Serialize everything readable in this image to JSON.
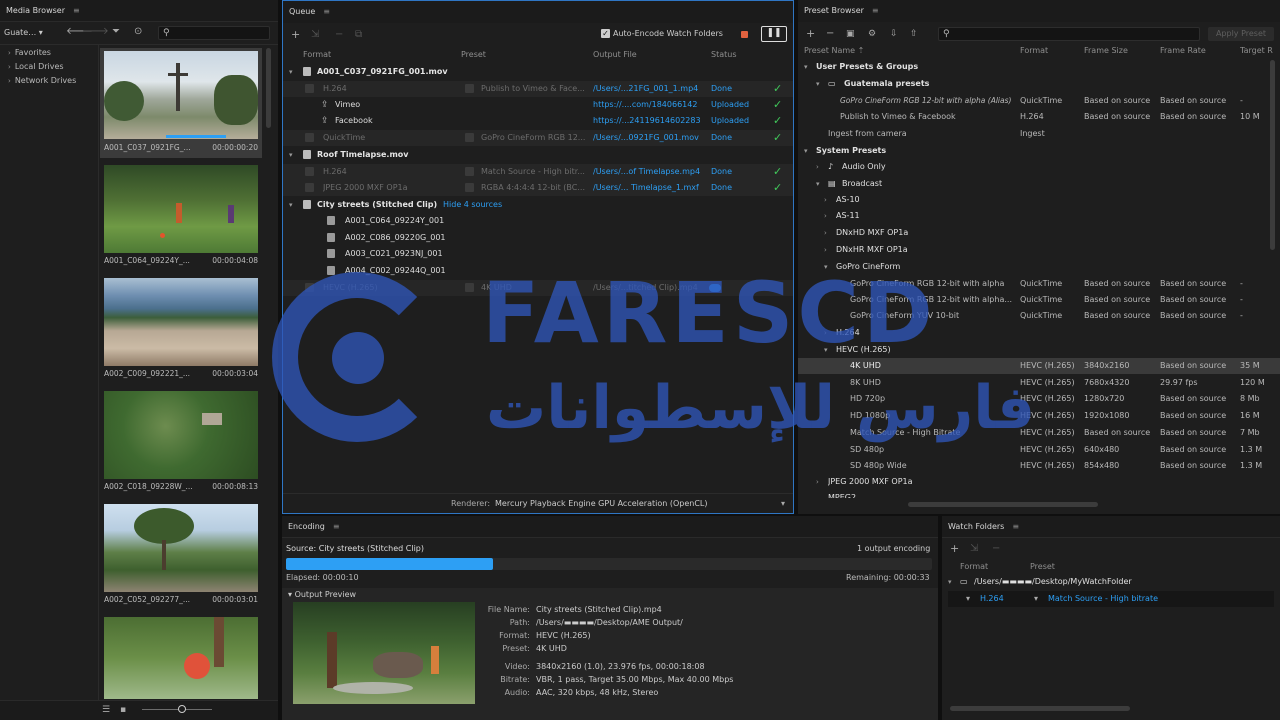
{
  "media_browser": {
    "title": "Media Browser",
    "location": "Guate…",
    "tree": [
      "Favorites",
      "Local Drives",
      "Network Drives"
    ],
    "clips": [
      {
        "name": "A001_C037_0921FG_...",
        "tc": "00:00:00:20"
      },
      {
        "name": "A001_C064_09224Y_...",
        "tc": "00:00:04:08"
      },
      {
        "name": "A002_C009_092221_...",
        "tc": "00:00:03:04"
      },
      {
        "name": "A002_C018_09228W_...",
        "tc": "00:00:08:13"
      },
      {
        "name": "A002_C052_092277_...",
        "tc": "00:00:03:01"
      }
    ]
  },
  "queue": {
    "title": "Queue",
    "auto_encode_label": "Auto-Encode Watch Folders",
    "columns": {
      "format": "Format",
      "preset": "Preset",
      "output": "Output File",
      "status": "Status"
    },
    "items": {
      "g1": "A001_C037_0921FG_001.mov",
      "g1_r1": {
        "format": "H.264",
        "preset": "Publish to Vimeo & Face...",
        "output": "/Users/...21FG_001_1.mp4",
        "status": "Done"
      },
      "g1_vimeo": {
        "name": "Vimeo",
        "output": "https://....com/184066142",
        "status": "Uploaded"
      },
      "g1_facebook": {
        "name": "Facebook",
        "output": "https://...24119614602283",
        "status": "Uploaded"
      },
      "g1_r2": {
        "format": "QuickTime",
        "preset": "GoPro CineForm RGB 12...",
        "output": "/Users/...0921FG_001.mov",
        "status": "Done"
      },
      "g2": "Roof Timelapse.mov",
      "g2_r1": {
        "format": "H.264",
        "preset": "Match Source - High bitr...",
        "output": "/Users/...of Timelapse.mp4",
        "status": "Done"
      },
      "g2_r2": {
        "format": "JPEG 2000 MXF OP1a",
        "preset": "RGBA 4:4:4:4 12-bit (BC...",
        "output": "/Users/... Timelapse_1.mxf",
        "status": "Done"
      },
      "g3": "City streets (Stitched Clip)",
      "g3_link": "Hide 4 sources",
      "sources": [
        "A001_C064_09224Y_001",
        "A002_C086_09220G_001",
        "A003_C021_0923NJ_001",
        "A004_C002_09244Q_001"
      ],
      "g3_r1": {
        "format": "HEVC (H.265)",
        "preset": "4K UHD",
        "output": "/Users/...titched Clip).mp4"
      }
    },
    "renderer_label": "Renderer:",
    "renderer_value": "Mercury Playback Engine GPU Acceleration (OpenCL)"
  },
  "preset_browser": {
    "title": "Preset Browser",
    "apply_label": "Apply Preset",
    "columns": {
      "name": "Preset Name",
      "format": "Format",
      "frame_size": "Frame Size",
      "frame_rate": "Frame Rate",
      "target": "Target R"
    },
    "user_group": "User Presets & Groups",
    "guatemala": "Guatemala presets",
    "user_rows": [
      {
        "name": "GoPro CineForm RGB 12-bit with alpha (Alias)",
        "format": "QuickTime",
        "fs": "Based on source",
        "fr": "Based on source",
        "tr": "-"
      },
      {
        "name": "Publish to Vimeo & Facebook",
        "format": "H.264",
        "fs": "Based on source",
        "fr": "Based on source",
        "tr": "10 M"
      }
    ],
    "ingest": {
      "name": "Ingest from camera",
      "format": "Ingest"
    },
    "system_group": "System Presets",
    "audio_only": "Audio Only",
    "broadcast": "Broadcast",
    "bc_items": [
      "AS-10",
      "AS-11",
      "DNxHD MXF OP1a",
      "DNxHR MXF OP1a"
    ],
    "gopro_group": "GoPro CineForm",
    "gopro_rows": [
      {
        "name": "GoPro CineForm RGB 12-bit with alpha",
        "format": "QuickTime",
        "fs": "Based on source",
        "fr": "Based on source",
        "tr": "-"
      },
      {
        "name": "GoPro CineForm RGB 12-bit with alpha...",
        "format": "QuickTime",
        "fs": "Based on source",
        "fr": "Based on source",
        "tr": "-"
      },
      {
        "name": "GoPro CineForm YUV 10-bit",
        "format": "QuickTime",
        "fs": "Based on source",
        "fr": "Based on source",
        "tr": "-"
      }
    ],
    "h264": "H.264",
    "hevc_group": "HEVC (H.265)",
    "hevc_rows": [
      {
        "name": "4K UHD",
        "format": "HEVC (H.265)",
        "fs": "3840x2160",
        "fr": "Based on source",
        "tr": "35 M"
      },
      {
        "name": "8K UHD",
        "format": "HEVC (H.265)",
        "fs": "7680x4320",
        "fr": "29.97 fps",
        "tr": "120 M"
      },
      {
        "name": "HD 720p",
        "format": "HEVC (H.265)",
        "fs": "1280x720",
        "fr": "Based on source",
        "tr": "8 Mb"
      },
      {
        "name": "HD 1080p",
        "format": "HEVC (H.265)",
        "fs": "1920x1080",
        "fr": "Based on source",
        "tr": "16 M"
      },
      {
        "name": "Match Source - High Bitrate",
        "format": "HEVC (H.265)",
        "fs": "Based on source",
        "fr": "Based on source",
        "tr": "7 Mb"
      },
      {
        "name": "SD 480p",
        "format": "HEVC (H.265)",
        "fs": "640x480",
        "fr": "Based on source",
        "tr": "1.3 M"
      },
      {
        "name": "SD 480p Wide",
        "format": "HEVC (H.265)",
        "fs": "854x480",
        "fr": "Based on source",
        "tr": "1.3 M"
      }
    ],
    "jpeg2000": "JPEG 2000 MXF OP1a",
    "mpeg2": "MPEG2"
  },
  "encoding": {
    "title": "Encoding",
    "source": "Source: City streets (Stitched Clip)",
    "count": "1 output encoding",
    "progress": 0.32,
    "elapsed": "Elapsed: 00:00:10",
    "remaining": "Remaining: 00:00:33",
    "preview_label": "Output Preview",
    "info": [
      {
        "k": "File Name:",
        "v": "City streets (Stitched Clip).mp4"
      },
      {
        "k": "Path:",
        "v": "/Users/▬▬▬▬/Desktop/AME Output/"
      },
      {
        "k": "Format:",
        "v": "HEVC (H.265)"
      },
      {
        "k": "Preset:",
        "v": "4K UHD"
      },
      {
        "k": "Video:",
        "v": "3840x2160 (1.0), 23.976 fps, 00:00:18:08"
      },
      {
        "k": "Bitrate:",
        "v": "VBR, 1 pass, Target 35.00 Mbps, Max 40.00 Mbps"
      },
      {
        "k": "Audio:",
        "v": "AAC, 320 kbps, 48 kHz, Stereo"
      }
    ]
  },
  "watch_folders": {
    "title": "Watch Folders",
    "col_format": "Format",
    "col_preset": "Preset",
    "folder": "/Users/▬▬▬▬/Desktop/MyWatchFolder",
    "row_format": "H.264",
    "row_preset": "Match Source - High bitrate"
  },
  "watermark": {
    "latin": "FARESCD",
    "arabic": "فارس للإسطوانات",
    "color": "#2f56b8"
  }
}
